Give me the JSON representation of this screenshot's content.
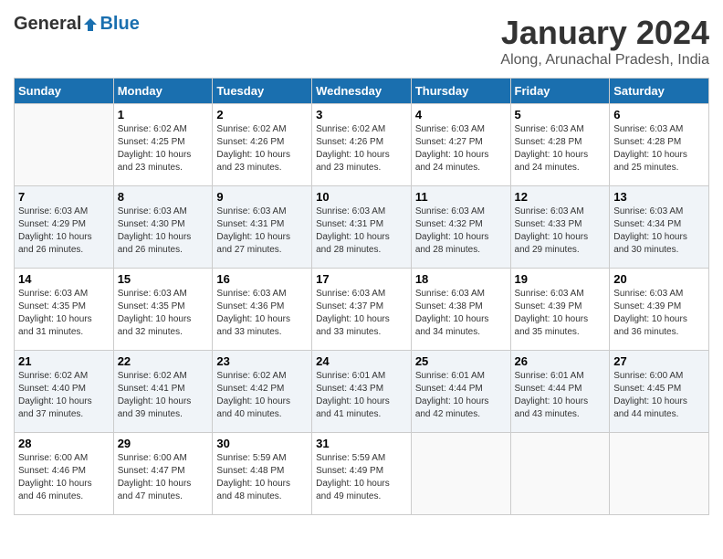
{
  "header": {
    "logo_general": "General",
    "logo_blue": "Blue",
    "month_title": "January 2024",
    "location": "Along, Arunachal Pradesh, India"
  },
  "days_of_week": [
    "Sunday",
    "Monday",
    "Tuesday",
    "Wednesday",
    "Thursday",
    "Friday",
    "Saturday"
  ],
  "weeks": [
    [
      {
        "day": "",
        "info": ""
      },
      {
        "day": "1",
        "info": "Sunrise: 6:02 AM\nSunset: 4:25 PM\nDaylight: 10 hours\nand 23 minutes."
      },
      {
        "day": "2",
        "info": "Sunrise: 6:02 AM\nSunset: 4:26 PM\nDaylight: 10 hours\nand 23 minutes."
      },
      {
        "day": "3",
        "info": "Sunrise: 6:02 AM\nSunset: 4:26 PM\nDaylight: 10 hours\nand 23 minutes."
      },
      {
        "day": "4",
        "info": "Sunrise: 6:03 AM\nSunset: 4:27 PM\nDaylight: 10 hours\nand 24 minutes."
      },
      {
        "day": "5",
        "info": "Sunrise: 6:03 AM\nSunset: 4:28 PM\nDaylight: 10 hours\nand 24 minutes."
      },
      {
        "day": "6",
        "info": "Sunrise: 6:03 AM\nSunset: 4:28 PM\nDaylight: 10 hours\nand 25 minutes."
      }
    ],
    [
      {
        "day": "7",
        "info": "Sunrise: 6:03 AM\nSunset: 4:29 PM\nDaylight: 10 hours\nand 26 minutes."
      },
      {
        "day": "8",
        "info": "Sunrise: 6:03 AM\nSunset: 4:30 PM\nDaylight: 10 hours\nand 26 minutes."
      },
      {
        "day": "9",
        "info": "Sunrise: 6:03 AM\nSunset: 4:31 PM\nDaylight: 10 hours\nand 27 minutes."
      },
      {
        "day": "10",
        "info": "Sunrise: 6:03 AM\nSunset: 4:31 PM\nDaylight: 10 hours\nand 28 minutes."
      },
      {
        "day": "11",
        "info": "Sunrise: 6:03 AM\nSunset: 4:32 PM\nDaylight: 10 hours\nand 28 minutes."
      },
      {
        "day": "12",
        "info": "Sunrise: 6:03 AM\nSunset: 4:33 PM\nDaylight: 10 hours\nand 29 minutes."
      },
      {
        "day": "13",
        "info": "Sunrise: 6:03 AM\nSunset: 4:34 PM\nDaylight: 10 hours\nand 30 minutes."
      }
    ],
    [
      {
        "day": "14",
        "info": "Sunrise: 6:03 AM\nSunset: 4:35 PM\nDaylight: 10 hours\nand 31 minutes."
      },
      {
        "day": "15",
        "info": "Sunrise: 6:03 AM\nSunset: 4:35 PM\nDaylight: 10 hours\nand 32 minutes."
      },
      {
        "day": "16",
        "info": "Sunrise: 6:03 AM\nSunset: 4:36 PM\nDaylight: 10 hours\nand 33 minutes."
      },
      {
        "day": "17",
        "info": "Sunrise: 6:03 AM\nSunset: 4:37 PM\nDaylight: 10 hours\nand 33 minutes."
      },
      {
        "day": "18",
        "info": "Sunrise: 6:03 AM\nSunset: 4:38 PM\nDaylight: 10 hours\nand 34 minutes."
      },
      {
        "day": "19",
        "info": "Sunrise: 6:03 AM\nSunset: 4:39 PM\nDaylight: 10 hours\nand 35 minutes."
      },
      {
        "day": "20",
        "info": "Sunrise: 6:03 AM\nSunset: 4:39 PM\nDaylight: 10 hours\nand 36 minutes."
      }
    ],
    [
      {
        "day": "21",
        "info": "Sunrise: 6:02 AM\nSunset: 4:40 PM\nDaylight: 10 hours\nand 37 minutes."
      },
      {
        "day": "22",
        "info": "Sunrise: 6:02 AM\nSunset: 4:41 PM\nDaylight: 10 hours\nand 39 minutes."
      },
      {
        "day": "23",
        "info": "Sunrise: 6:02 AM\nSunset: 4:42 PM\nDaylight: 10 hours\nand 40 minutes."
      },
      {
        "day": "24",
        "info": "Sunrise: 6:01 AM\nSunset: 4:43 PM\nDaylight: 10 hours\nand 41 minutes."
      },
      {
        "day": "25",
        "info": "Sunrise: 6:01 AM\nSunset: 4:44 PM\nDaylight: 10 hours\nand 42 minutes."
      },
      {
        "day": "26",
        "info": "Sunrise: 6:01 AM\nSunset: 4:44 PM\nDaylight: 10 hours\nand 43 minutes."
      },
      {
        "day": "27",
        "info": "Sunrise: 6:00 AM\nSunset: 4:45 PM\nDaylight: 10 hours\nand 44 minutes."
      }
    ],
    [
      {
        "day": "28",
        "info": "Sunrise: 6:00 AM\nSunset: 4:46 PM\nDaylight: 10 hours\nand 46 minutes."
      },
      {
        "day": "29",
        "info": "Sunrise: 6:00 AM\nSunset: 4:47 PM\nDaylight: 10 hours\nand 47 minutes."
      },
      {
        "day": "30",
        "info": "Sunrise: 5:59 AM\nSunset: 4:48 PM\nDaylight: 10 hours\nand 48 minutes."
      },
      {
        "day": "31",
        "info": "Sunrise: 5:59 AM\nSunset: 4:49 PM\nDaylight: 10 hours\nand 49 minutes."
      },
      {
        "day": "",
        "info": ""
      },
      {
        "day": "",
        "info": ""
      },
      {
        "day": "",
        "info": ""
      }
    ]
  ]
}
